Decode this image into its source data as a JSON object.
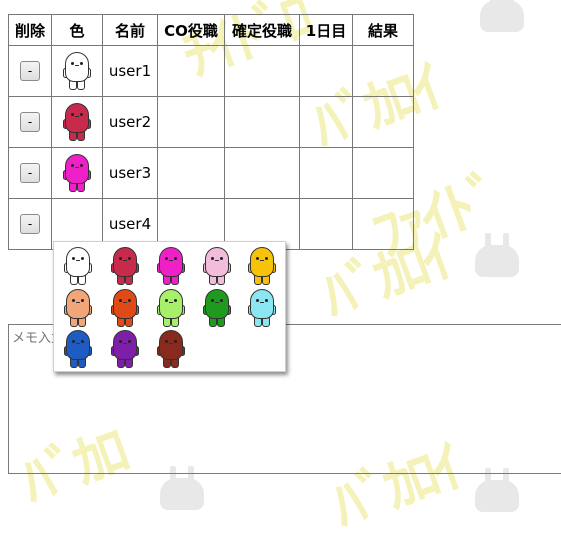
{
  "table": {
    "headers": [
      "削除",
      "色",
      "名前",
      "CO役職",
      "確定役職",
      "1日目",
      "結果"
    ],
    "delete_label": "-",
    "rows": [
      {
        "name": "user1",
        "color": "#ffffff",
        "color_name": "white"
      },
      {
        "name": "user2",
        "color": "#c72a4a",
        "color_name": "crimson"
      },
      {
        "name": "user3",
        "color": "#f020c8",
        "color_name": "magenta"
      },
      {
        "name": "user4",
        "color": "",
        "color_name": "none"
      }
    ]
  },
  "color_picker": {
    "options": [
      {
        "color": "#ffffff",
        "name": "white"
      },
      {
        "color": "#c72a4a",
        "name": "crimson"
      },
      {
        "color": "#f020c8",
        "name": "magenta"
      },
      {
        "color": "#f2bcdc",
        "name": "pink"
      },
      {
        "color": "#f6c20a",
        "name": "yellow"
      },
      {
        "color": "#f2a578",
        "name": "peach"
      },
      {
        "color": "#e04a16",
        "name": "orange"
      },
      {
        "color": "#a6f06a",
        "name": "lime"
      },
      {
        "color": "#1f9a1f",
        "name": "green"
      },
      {
        "color": "#8ae6f0",
        "name": "cyan"
      },
      {
        "color": "#1e5cc4",
        "name": "blue"
      },
      {
        "color": "#7d1fa8",
        "name": "purple"
      },
      {
        "color": "#8a2a1e",
        "name": "brown"
      }
    ]
  },
  "memo": {
    "placeholder": "メモ入力"
  }
}
